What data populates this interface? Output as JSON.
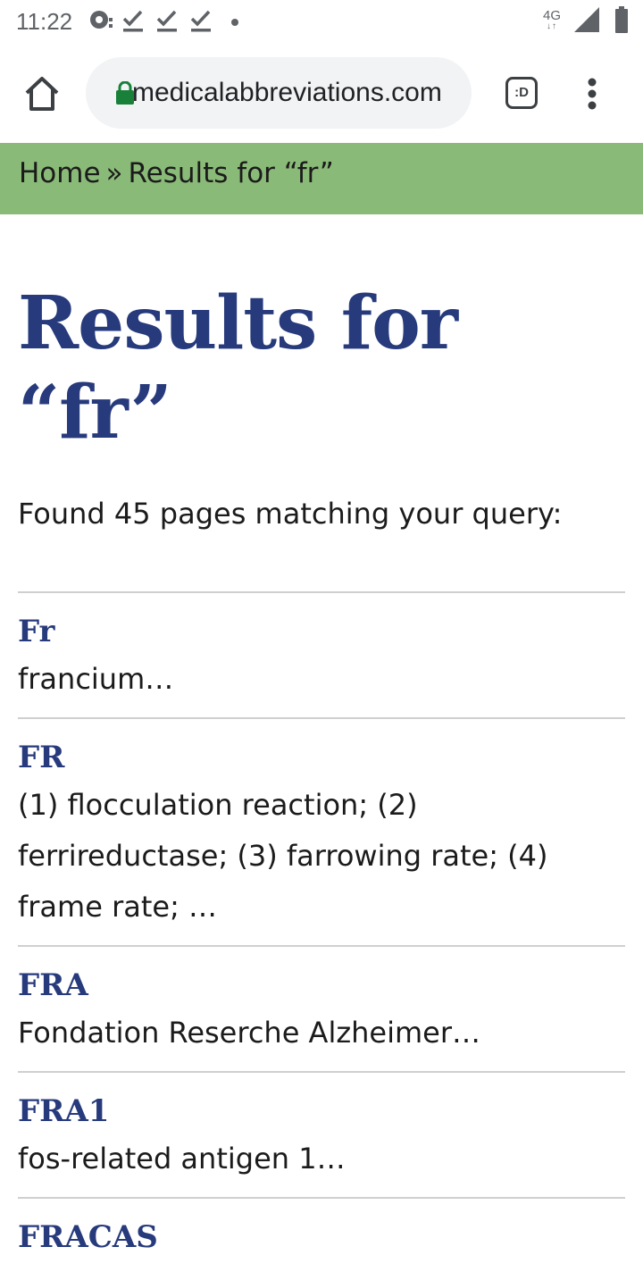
{
  "status_bar": {
    "time": "11:22",
    "network": "4G",
    "network_arrows": "↓↑",
    "icons": [
      "data-saver-icon",
      "download-done-icon",
      "download-done-icon",
      "download-done-icon",
      "notification-dot-icon",
      "signal-icon",
      "battery-icon"
    ]
  },
  "browser": {
    "url": "medicalabbreviations.com",
    "tab_switcher_label": ":D",
    "icons": [
      "home-icon",
      "lock-icon",
      "tab-switcher-icon",
      "more-vert-icon"
    ],
    "colors": {
      "lock": "#188038"
    }
  },
  "breadcrumb": {
    "home": "Home",
    "separator": "»",
    "current": "Results for “fr”"
  },
  "page": {
    "title": "Results for “fr”",
    "found_text": "Found 45 pages matching your query:"
  },
  "results": [
    {
      "title": "Fr",
      "snippet": "francium…"
    },
    {
      "title": "FR",
      "snippet": "(1) flocculation reaction; (2) ferrireductase; (3) farrowing rate; (4) frame rate; …"
    },
    {
      "title": "FRA",
      "snippet": "Fondation Reserche Alzheimer…"
    },
    {
      "title": "FRA1",
      "snippet": "fos-related antigen 1…"
    },
    {
      "title": "FRACAS",
      "snippet": ""
    }
  ],
  "colors": {
    "breadcrumb_bg": "#8aba78",
    "title": "#263a7c",
    "text": "#1b1b1b",
    "divider": "#cfcfcf"
  }
}
